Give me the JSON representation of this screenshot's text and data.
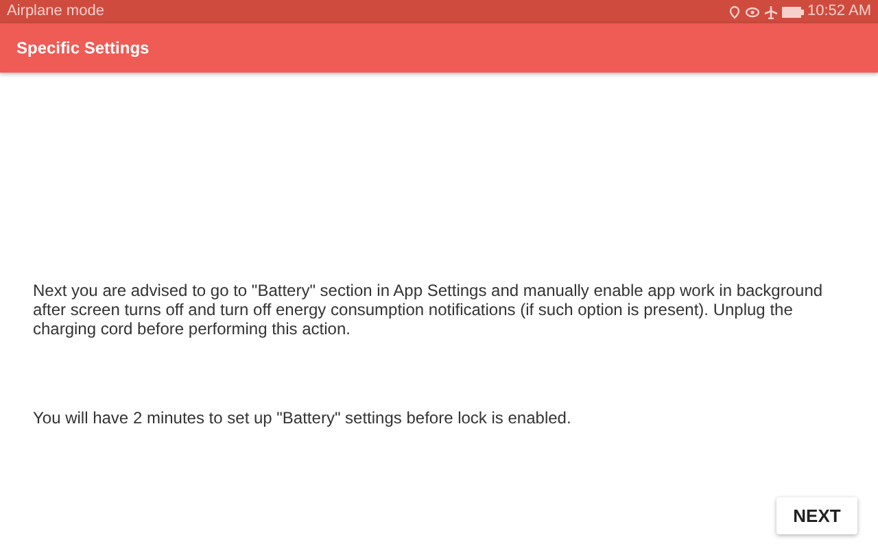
{
  "status_bar": {
    "carrier": "Airplane mode",
    "time": "10:52 AM"
  },
  "app_bar": {
    "title": "Specific Settings"
  },
  "paragraphs": [
    "Next you are advised to go to \"Battery\" section in App Settings and manually enable app work in background after screen turns off and turn off energy consumption notifications (if such option is present). Unplug the charging cord before performing this action.",
    "You will have 2 minutes to set up \"Battery\" settings before lock is enabled."
  ],
  "button": "NEXT"
}
